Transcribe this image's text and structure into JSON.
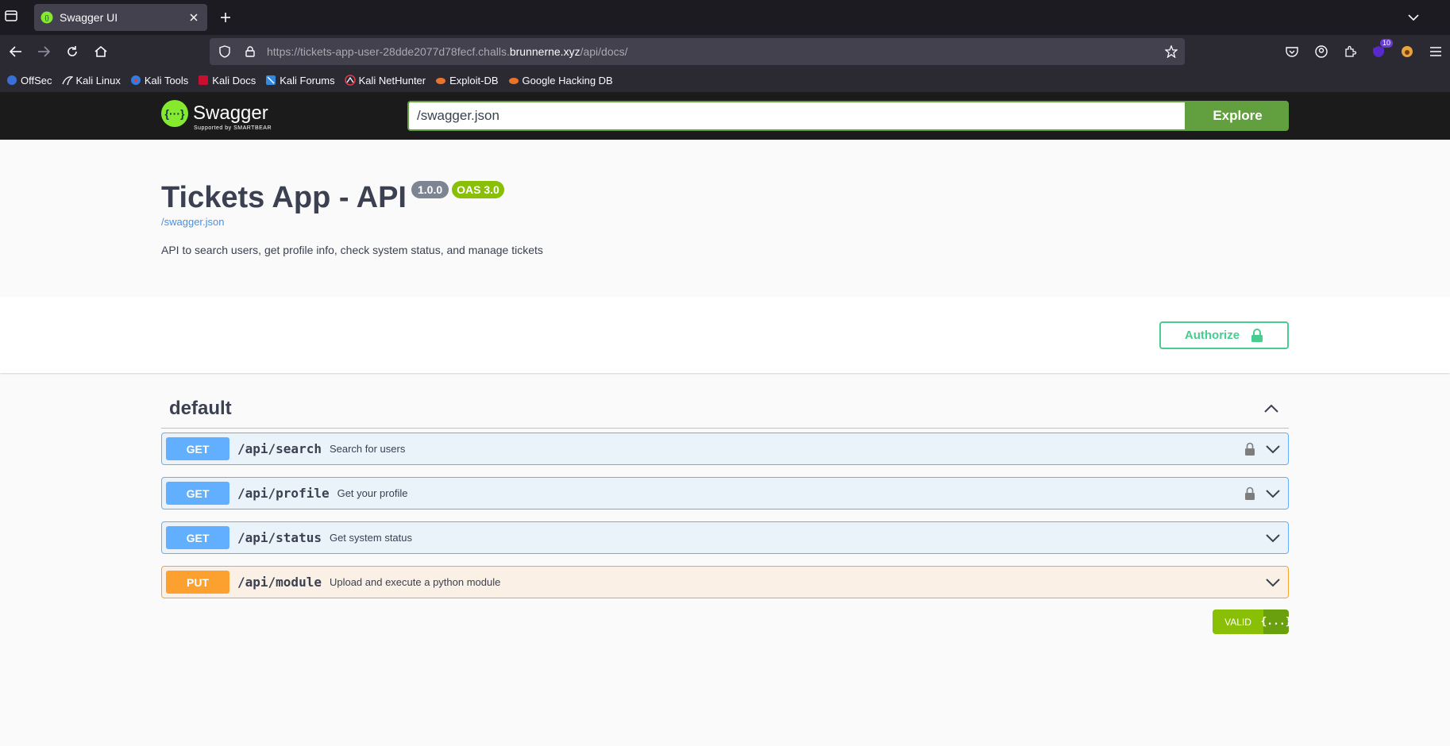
{
  "browser": {
    "tab_title": "Swagger UI",
    "url_prefix": "https://tickets-app-user-28dde2077d78fecf.challs.",
    "url_host": "brunnerne.xyz",
    "url_path": "/api/docs/",
    "extension_badge": "10",
    "bookmarks": [
      {
        "label": "OffSec",
        "icon": "offsec-icon"
      },
      {
        "label": "Kali Linux",
        "icon": "kali-dragon-icon"
      },
      {
        "label": "Kali Tools",
        "icon": "kali-tools-icon"
      },
      {
        "label": "Kali Docs",
        "icon": "kali-docs-icon"
      },
      {
        "label": "Kali Forums",
        "icon": "kali-forums-icon"
      },
      {
        "label": "Kali NetHunter",
        "icon": "kali-nethunter-icon"
      },
      {
        "label": "Exploit-DB",
        "icon": "exploit-db-icon"
      },
      {
        "label": "Google Hacking DB",
        "icon": "ghdb-icon"
      }
    ]
  },
  "swagger": {
    "logo_text": "Swagger",
    "logo_sub": "Supported by SMARTBEAR",
    "spec_url": "/swagger.json",
    "explore_label": "Explore",
    "accent": "#62a03f"
  },
  "info": {
    "title": "Tickets App - API",
    "version": "1.0.0",
    "oas": "OAS 3.0",
    "link": "/swagger.json",
    "description": "API to search users, get profile info, check system status, and manage tickets"
  },
  "authorize_label": "Authorize",
  "tag": {
    "name": "default"
  },
  "operations": [
    {
      "method": "GET",
      "path": "/api/search",
      "summary": "Search for users",
      "locked": true
    },
    {
      "method": "GET",
      "path": "/api/profile",
      "summary": "Get your profile",
      "locked": true
    },
    {
      "method": "GET",
      "path": "/api/status",
      "summary": "Get system status",
      "locked": false
    },
    {
      "method": "PUT",
      "path": "/api/module",
      "summary": "Upload and execute a python module",
      "locked": false
    }
  ],
  "validator": {
    "label": "VALID",
    "icon_text": "{...}"
  },
  "colors": {
    "get": "#61affe",
    "put": "#fca130",
    "authorize": "#49cc90",
    "valid": "#89bf04"
  }
}
